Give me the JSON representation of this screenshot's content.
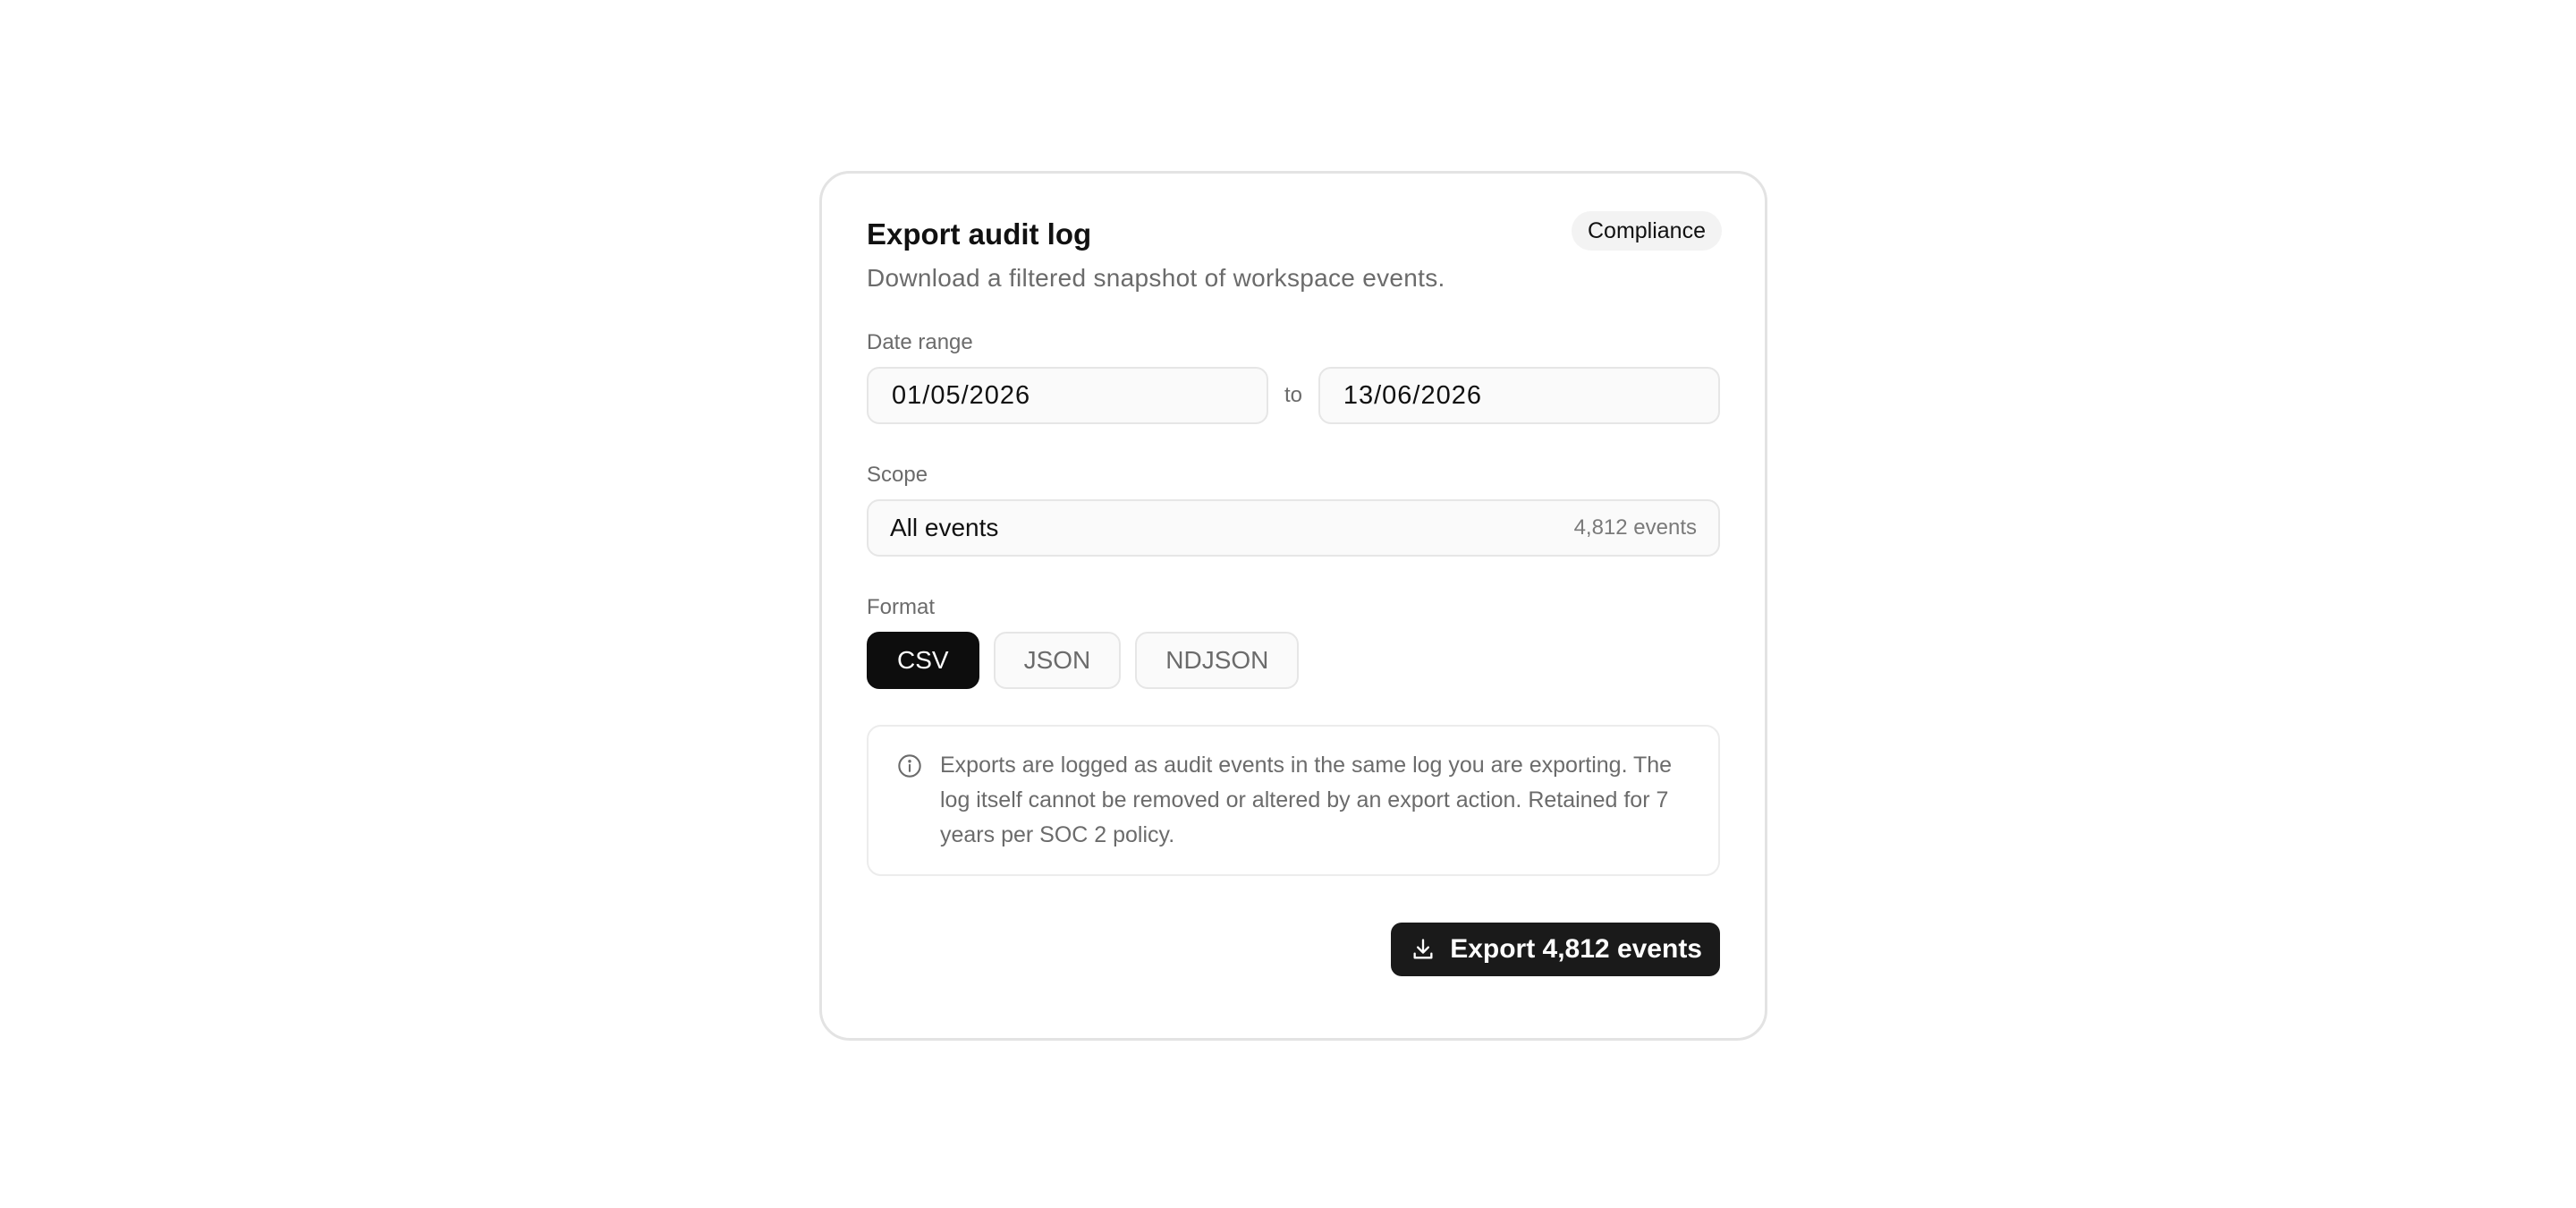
{
  "card": {
    "title": "Export audit log",
    "subtitle": "Download a filtered snapshot of workspace events.",
    "badge": "Compliance"
  },
  "date_range": {
    "label": "Date range",
    "from": "01/05/2026",
    "separator": "to",
    "to": "13/06/2026"
  },
  "scope": {
    "label": "Scope",
    "value": "All events",
    "count": "4,812 events"
  },
  "format": {
    "label": "Format",
    "options": [
      {
        "label": "CSV",
        "selected": true
      },
      {
        "label": "JSON",
        "selected": false
      },
      {
        "label": "NDJSON",
        "selected": false
      }
    ]
  },
  "notice": {
    "icon": "info-icon",
    "text": "Exports are logged as audit events in the same log you are exporting. The log itself cannot be removed or altered by an export action. Retained for 7 years per SOC 2 policy."
  },
  "export_button": {
    "icon": "download-icon",
    "label": "Export 4,812 events"
  },
  "colors": {
    "primary": "#0d0d0d",
    "muted_text": "#6b6b6b",
    "border": "#e3e3e3"
  }
}
